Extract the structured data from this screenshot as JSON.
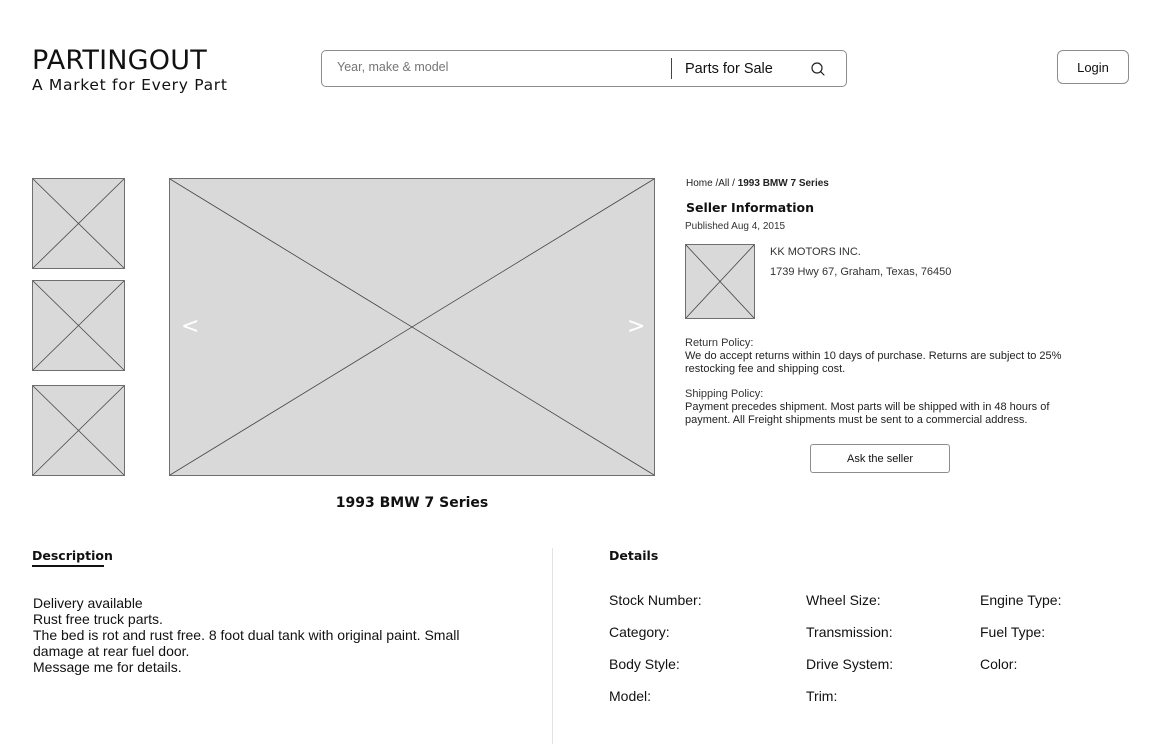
{
  "header": {
    "logo_title": "PARTINGOUT",
    "logo_tagline": "A Market for Every Part",
    "search_placeholder": "Year, make & model",
    "search_category": "Parts for Sale",
    "login_label": "Login"
  },
  "gallery": {
    "prev_arrow": "<",
    "next_arrow": ">"
  },
  "product": {
    "title": "1993 BMW 7 Series"
  },
  "breadcrumb": {
    "path": "Home /All / ",
    "current": "1993 BMW 7 Series"
  },
  "seller": {
    "heading": "Seller Information",
    "published": "Published Aug 4, 2015",
    "name": "KK MOTORS INC.",
    "address": "1739 Hwy 67, Graham, Texas, 76450",
    "return_label": "Return Policy:",
    "return_text": "We do accept returns within 10 days of purchase. Returns are subject to 25% restocking fee and shipping cost.",
    "shipping_label": "Shipping Policy:",
    "shipping_text": "Payment precedes shipment. Most parts will be shipped with in 48 hours of payment. All Freight shipments must be sent to a commercial address.",
    "ask_label": "Ask the seller"
  },
  "description": {
    "tab_label": "Description",
    "lines": [
      "Delivery available",
      "Rust free truck parts.",
      "The bed is rot and rust free. 8 foot dual tank with original paint. Small",
      "damage at rear fuel door.",
      "Message me for details."
    ]
  },
  "details": {
    "heading": "Details",
    "fields": [
      "Stock Number:",
      "Wheel Size:",
      "Engine Type:",
      "Category:",
      "Transmission:",
      "Fuel Type:",
      "Body Style:",
      "Drive System:",
      "Color:",
      "Model:",
      "Trim:"
    ]
  },
  "colors": {
    "placeholder_fill": "#d9d9d9",
    "border": "#8d8d8d",
    "text": "#111111"
  },
  "icons": {
    "search": "search-icon"
  }
}
